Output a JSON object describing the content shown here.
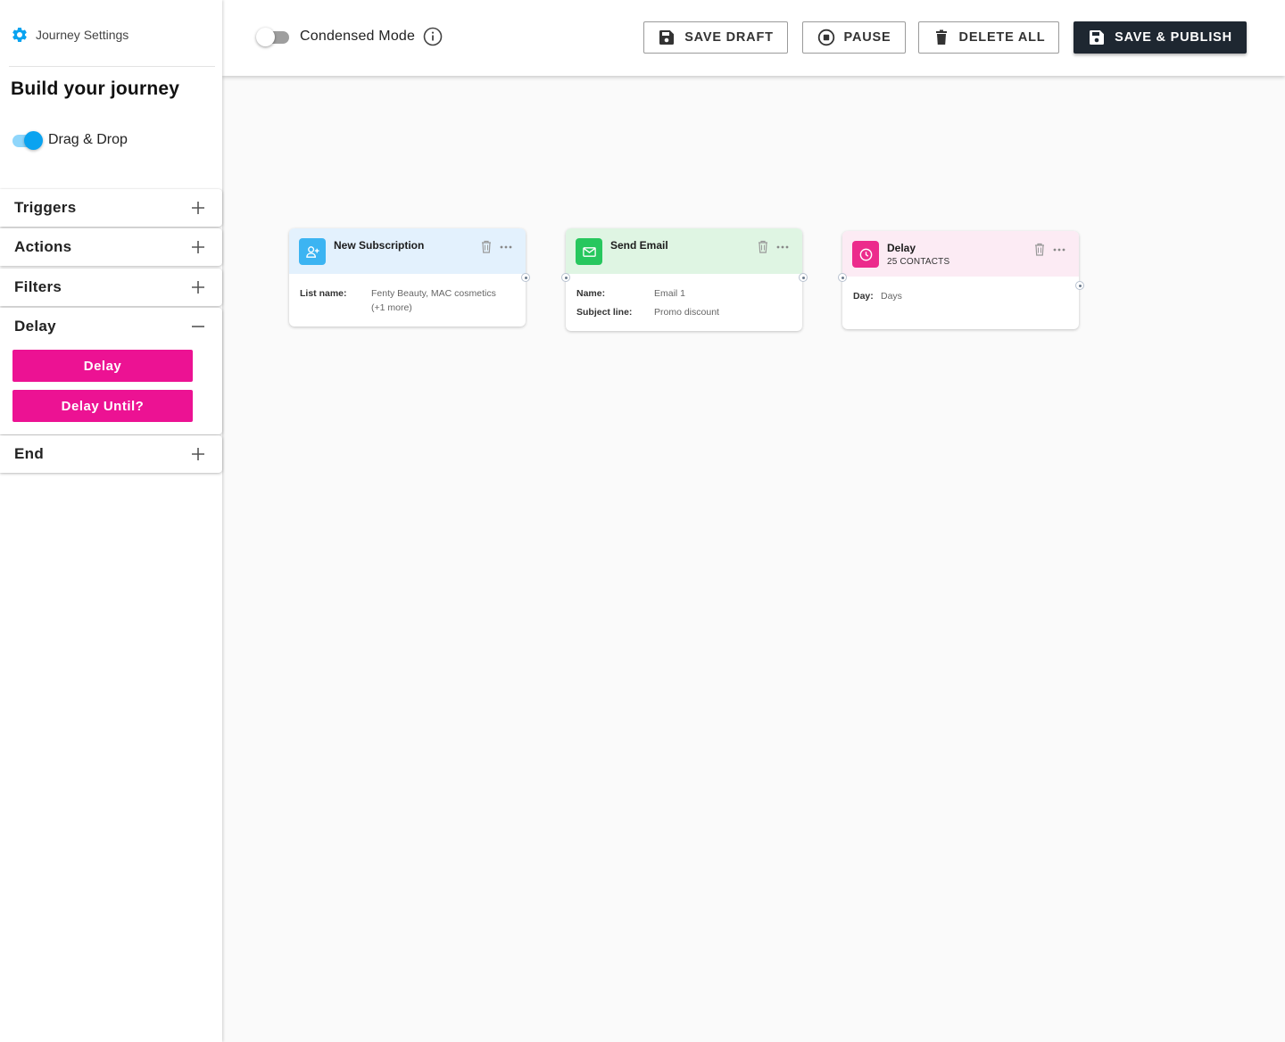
{
  "sidebar": {
    "settings_label": "Journey Settings",
    "title": "Build your journey",
    "drag_drop_label": "Drag & Drop",
    "sections": {
      "triggers": "Triggers",
      "actions": "Actions",
      "filters": "Filters",
      "delay": "Delay",
      "end": "End"
    },
    "delay_buttons": [
      "Delay",
      "Delay Until?"
    ]
  },
  "topbar": {
    "condensed_label": "Condensed Mode",
    "save_draft": "SAVE DRAFT",
    "pause": "PAUSE",
    "delete_all": "DELETE ALL",
    "save_publish": "SAVE & PUBLISH"
  },
  "nodes": {
    "subscription": {
      "title": "New Subscription",
      "list_name_label": "List name:",
      "list_name_value": "Fenty Beauty, MAC cosmetics",
      "list_name_more": "(+1 more)",
      "color": "#e3f1fd",
      "icon_color": "#3cb4f2"
    },
    "email": {
      "title": "Send Email",
      "name_label": "Name:",
      "name_value": "Email 1",
      "subject_label": "Subject line:",
      "subject_value": "Promo discount",
      "color": "#dff5e3",
      "icon_color": "#27c75e"
    },
    "delay": {
      "title": "Delay",
      "contacts": "25 CONTACTS",
      "day_label": "Day:",
      "day_value": "Days",
      "color": "#fcebf4",
      "icon_color": "#ec2b8c"
    }
  },
  "colors": {
    "accent_blue": "#0aa3f0",
    "pink": "#ec1293",
    "dark_button": "#1e2731"
  }
}
